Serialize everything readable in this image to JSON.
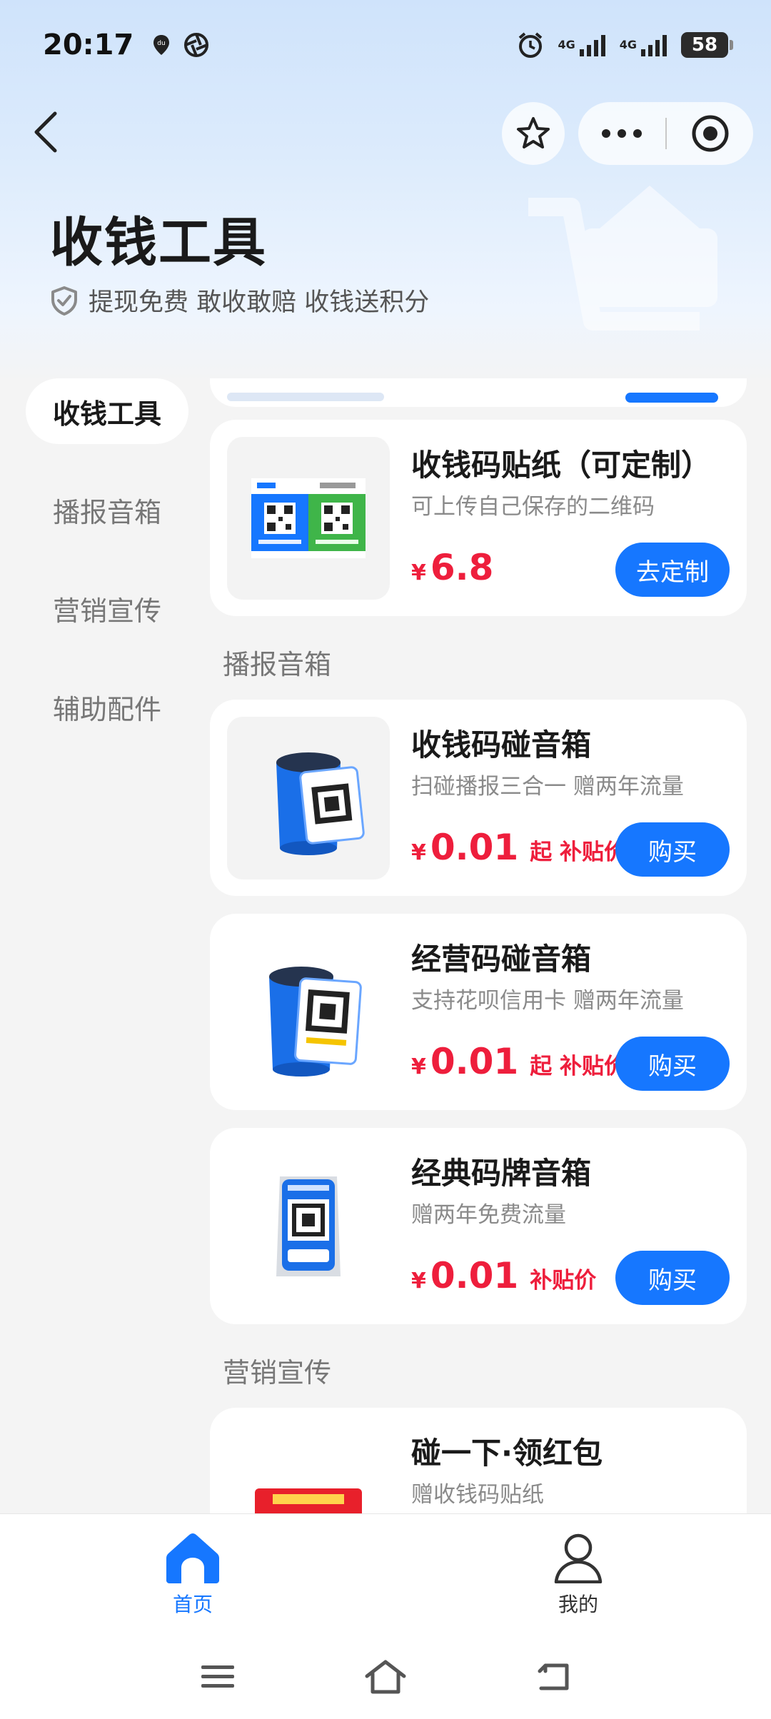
{
  "status_bar": {
    "time": "20:17",
    "network_1": "4G",
    "network_2": "4G",
    "battery": "58"
  },
  "header": {
    "title": "收钱工具",
    "subtitle": "提现免费 敢收敢赔 收钱送积分"
  },
  "side_nav": [
    {
      "label": "收钱工具",
      "active": true
    },
    {
      "label": "播报音箱",
      "active": false
    },
    {
      "label": "营销宣传",
      "active": false
    },
    {
      "label": "辅助配件",
      "active": false
    }
  ],
  "cards": {
    "sticker": {
      "title": "收钱码贴纸（可定制）",
      "desc": "可上传自己保存的二维码",
      "currency": "¥",
      "price": "6.8",
      "action": "去定制"
    },
    "speaker_tap": {
      "title": "收钱码碰音箱",
      "desc": "扫碰播报三合一 赠两年流量",
      "currency": "¥",
      "price": "0.01",
      "suffix": "起 补贴价",
      "action": "购买"
    },
    "speaker_biz": {
      "title": "经营码碰音箱",
      "desc": "支持花呗信用卡 赠两年流量",
      "currency": "¥",
      "price": "0.01",
      "suffix": "起 补贴价",
      "action": "购买"
    },
    "speaker_classic": {
      "title": "经典码牌音箱",
      "desc": "赠两年免费流量",
      "currency": "¥",
      "price": "0.01",
      "suffix": "补贴价",
      "action": "购买"
    },
    "promo": {
      "title": "碰一下·领红包",
      "desc": "赠收钱码贴纸"
    }
  },
  "sections": {
    "speaker": "播报音箱",
    "marketing": "营销宣传"
  },
  "tabbar": {
    "home": "首页",
    "mine": "我的"
  },
  "colors": {
    "accent": "#1677ff",
    "price": "#ee1e3c"
  }
}
